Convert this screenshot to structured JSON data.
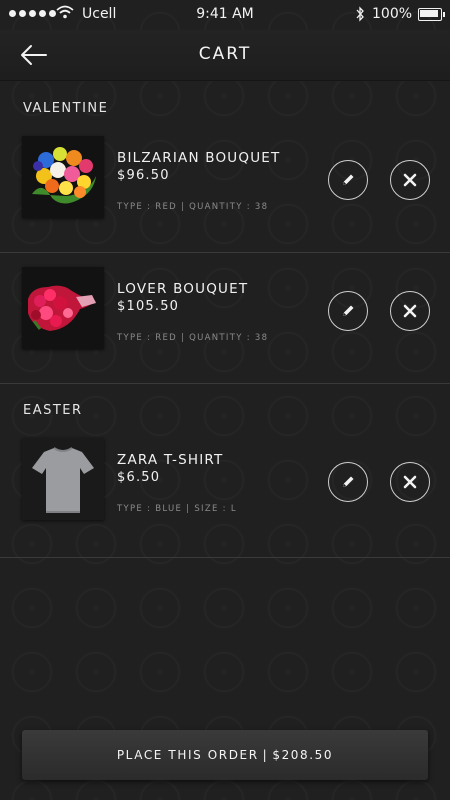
{
  "status_bar": {
    "carrier": "Ucell",
    "time": "9:41 AM",
    "battery": "100%"
  },
  "nav": {
    "title": "CART",
    "back_icon": "arrow-left-icon"
  },
  "sections": [
    {
      "title": "VALENTINE",
      "items": [
        {
          "name": "BILZARIAN BOUQUET",
          "price": "$96.50",
          "meta": "TYPE : RED | QUANTITY : 38",
          "image": "colorful-bouquet"
        },
        {
          "name": "LOVER BOUQUET",
          "price": "$105.50",
          "meta": "TYPE : RED | QUANTITY : 38",
          "image": "red-bouquet"
        }
      ]
    },
    {
      "title": "EASTER",
      "items": [
        {
          "name": "ZARA T-SHIRT",
          "price": "$6.50",
          "meta": "TYPE : BLUE | SIZE : L",
          "image": "grey-tshirt"
        }
      ]
    }
  ],
  "order_button": {
    "label": "PLACE THIS ORDER",
    "separator": "|",
    "total": "$208.50"
  },
  "colors": {
    "background": "#1f1f1f",
    "text": "#f1f1f1",
    "meta_text": "#8a8a8a",
    "button": "#333333"
  }
}
